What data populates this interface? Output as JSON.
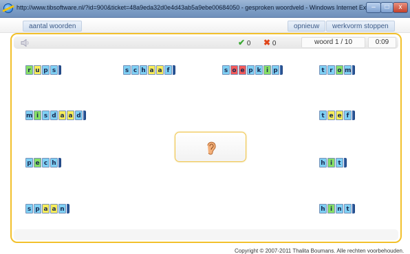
{
  "window": {
    "title": "http://www.tibsoftware.nl/?id=900&ticket=48a9eda32d0e4d43ab5a9ebe00684050 - gesproken woordveld - Windows Internet Explorer",
    "minimize": "–",
    "maximize": "□",
    "close": "x"
  },
  "toolbar": {
    "word_count": "aantal woorden",
    "restart": "opnieuw",
    "stop": "werkvorm stoppen"
  },
  "status": {
    "correct_count": "0",
    "wrong_count": "0",
    "word_progress": "woord 1 / 10",
    "timer": "0:09",
    "correct_color": "#3aa832",
    "wrong_color": "#e0461a"
  },
  "colors": {
    "blue": "#7fd0f4",
    "yellow": "#f7ec5a",
    "green": "#87de66",
    "red": "#f25a5a",
    "frame": "#f2c02a"
  },
  "words": [
    {
      "word": "rups",
      "letters": [
        "r",
        "u",
        "p",
        "s"
      ],
      "colors": [
        "green",
        "yellow",
        "blue",
        "blue"
      ]
    },
    {
      "word": "schaaf",
      "letters": [
        "s",
        "c",
        "h",
        "a",
        "a",
        "f"
      ],
      "colors": [
        "blue",
        "blue",
        "blue",
        "yellow",
        "yellow",
        "blue"
      ]
    },
    {
      "word": "soepkip",
      "letters": [
        "s",
        "o",
        "e",
        "p",
        "k",
        "i",
        "p"
      ],
      "colors": [
        "blue",
        "red",
        "red",
        "blue",
        "blue",
        "green",
        "blue"
      ]
    },
    {
      "word": "trom",
      "letters": [
        "t",
        "r",
        "o",
        "m"
      ],
      "colors": [
        "blue",
        "blue",
        "green",
        "blue"
      ]
    },
    {
      "word": "misdaad",
      "letters": [
        "m",
        "i",
        "s",
        "d",
        "a",
        "a",
        "d"
      ],
      "colors": [
        "blue",
        "green",
        "blue",
        "blue",
        "yellow",
        "yellow",
        "blue"
      ]
    },
    {
      "word": "teef",
      "letters": [
        "t",
        "e",
        "e",
        "f"
      ],
      "colors": [
        "blue",
        "yellow",
        "yellow",
        "blue"
      ]
    },
    {
      "word": "pech",
      "letters": [
        "p",
        "e",
        "c",
        "h"
      ],
      "colors": [
        "blue",
        "green",
        "blue",
        "blue"
      ]
    },
    {
      "word": "hit",
      "letters": [
        "h",
        "i",
        "t"
      ],
      "colors": [
        "blue",
        "green",
        "blue"
      ]
    },
    {
      "word": "spaan",
      "letters": [
        "s",
        "p",
        "a",
        "a",
        "n"
      ],
      "colors": [
        "blue",
        "blue",
        "yellow",
        "yellow",
        "blue"
      ]
    },
    {
      "word": "hint",
      "letters": [
        "h",
        "i",
        "n",
        "t"
      ],
      "colors": [
        "blue",
        "green",
        "blue",
        "blue"
      ]
    }
  ],
  "center_button": {
    "icon": "ear-icon"
  },
  "speaker_icon": "speaker-icon",
  "footer": {
    "copyright": "Copyright © 2007-2011 Thalita Boumans. Alle rechten voorbehouden."
  }
}
